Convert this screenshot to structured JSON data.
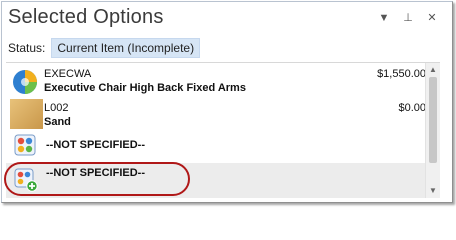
{
  "panel": {
    "title": "Selected Options",
    "controls": {
      "dropdown": "▼",
      "pin": "⊥",
      "close": "✕"
    }
  },
  "status": {
    "label": "Status:",
    "value": "Current Item (Incomplete)"
  },
  "items": [
    {
      "code": "EXECWA",
      "description": "Executive Chair High Back Fixed Arms",
      "price": "$1,550.00",
      "icon": "colorful-chart-icon"
    },
    {
      "code": "L002",
      "description": "Sand",
      "price": "$0.00",
      "icon": "sand-swatch-icon"
    },
    {
      "label": "--NOT SPECIFIED--",
      "icon": "option-group-icon"
    },
    {
      "label": "--NOT SPECIFIED--",
      "icon": "option-group-add-icon"
    }
  ],
  "scrollbar": {
    "up": "▲",
    "down": "▼"
  },
  "colors": {
    "highlight": "#b01818",
    "status_chip": "#d6e5f5",
    "selected_row": "#ececec"
  }
}
